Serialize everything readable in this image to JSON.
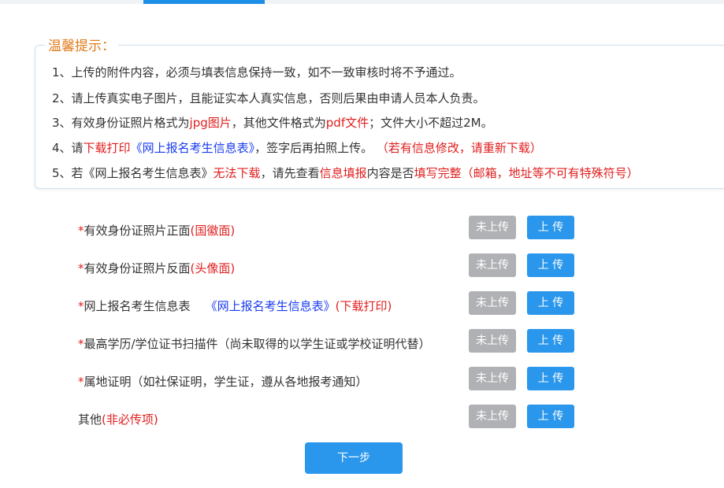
{
  "notice": {
    "title": "温馨提示：",
    "lines": [
      {
        "parts": [
          {
            "t": "1、上传的附件内容，必须与填表信息保持一致，如不一致审核时将不予通过。",
            "c": ""
          }
        ]
      },
      {
        "parts": [
          {
            "t": "2、请上传真实电子图片，且能证实本人真实信息，否则后果由申请人员本人负责。",
            "c": ""
          }
        ]
      },
      {
        "parts": [
          {
            "t": "3、有效身份证照片格式为",
            "c": ""
          },
          {
            "t": "jpg图片",
            "c": "red"
          },
          {
            "t": "，其他文件格式为",
            "c": ""
          },
          {
            "t": "pdf文件",
            "c": "red"
          },
          {
            "t": "；文件大小不超过2M。",
            "c": ""
          }
        ]
      },
      {
        "parts": [
          {
            "t": "4、请",
            "c": ""
          },
          {
            "t": "下载打印",
            "c": "red"
          },
          {
            "t": "《网上报名考生信息表》",
            "c": "blue"
          },
          {
            "t": "，签字后再拍照上传。 ",
            "c": ""
          },
          {
            "t": "（若有信息修改，请重新下载）",
            "c": "red"
          }
        ]
      },
      {
        "parts": [
          {
            "t": "5、若《网上报名考生信息表》",
            "c": ""
          },
          {
            "t": "无法下载",
            "c": "red"
          },
          {
            "t": "，请先查看",
            "c": ""
          },
          {
            "t": "信息填报",
            "c": "red"
          },
          {
            "t": "内容是否",
            "c": ""
          },
          {
            "t": "填写完整（邮箱，地址等不可有特殊符号）",
            "c": "red"
          }
        ]
      }
    ]
  },
  "uploads": [
    {
      "star": "*",
      "label": "有效身份证照片正面",
      "extra": "(国徽面)",
      "link": "",
      "status": "未上传",
      "button": "上 传"
    },
    {
      "star": "*",
      "label": "有效身份证照片反面",
      "extra": "(头像面)",
      "link": "",
      "status": "未上传",
      "button": "上 传"
    },
    {
      "star": "*",
      "label": "网上报名考生信息表    ",
      "extra": "(下载打印)",
      "link": "《网上报名考生信息表》",
      "status": "未上传",
      "button": "上 传"
    },
    {
      "star": "*",
      "label": "最高学历/学位证书扫描件（尚未取得的以学生证或学校证明代替）",
      "extra": "",
      "link": "",
      "status": "未上传",
      "button": "上 传"
    },
    {
      "star": "*",
      "label": "属地证明（如社保证明，学生证，遵从各地报考通知）",
      "extra": "",
      "link": "",
      "status": "未上传",
      "button": "上 传"
    },
    {
      "star": "",
      "label": "其他",
      "extra": "(非必传项)",
      "link": "",
      "status": "未上传",
      "button": "上 传"
    }
  ],
  "next_button": "下一步"
}
